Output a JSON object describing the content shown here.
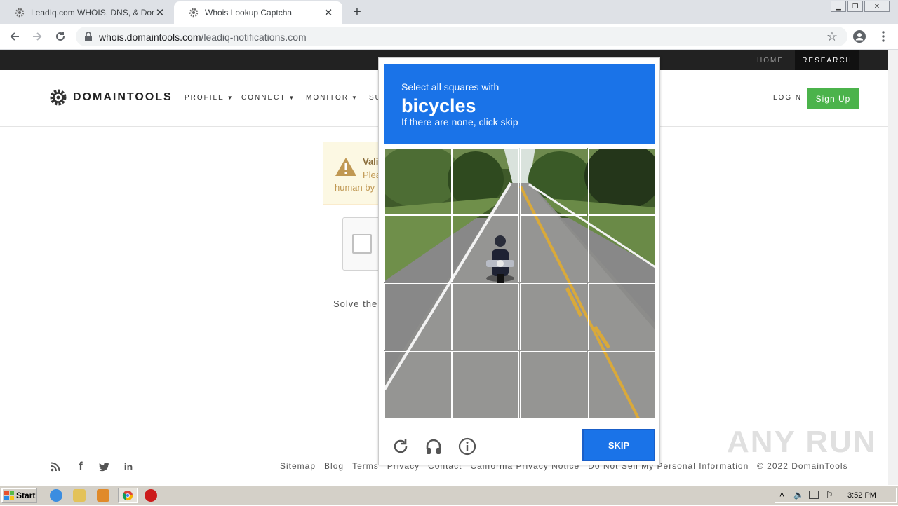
{
  "browser": {
    "tabs": [
      {
        "title": "LeadIq.com WHOIS, DNS, & Domain",
        "active": false
      },
      {
        "title": "Whois Lookup Captcha",
        "active": true
      }
    ],
    "url_host": "whois.domaintools.com",
    "url_path": "/leadiq-notifications.com"
  },
  "site": {
    "topbar": {
      "home": "HOME",
      "research": "RESEARCH"
    },
    "logo_text": "DOMAINTOOLS",
    "menu": [
      {
        "label": "PROFILE"
      },
      {
        "label": "CONNECT"
      },
      {
        "label": "MONITOR"
      },
      {
        "label": "SU"
      }
    ],
    "login": "LOGIN",
    "signup": "Sign Up",
    "notice": {
      "title": "Vali",
      "line1": "Plea",
      "line2": "human by"
    },
    "solve_text": "Solve the"
  },
  "captcha": {
    "instruction": "Select all squares with",
    "target": "bicycles",
    "hint": "If there are none, click skip",
    "skip_label": "SKIP",
    "accent": "#1a73e8"
  },
  "footer": {
    "links": [
      "Sitemap",
      "Blog",
      "Terms",
      "Privacy",
      "Contact",
      "California Privacy Notice",
      "Do Not Sell My Personal Information"
    ],
    "copyright": "© 2022 DomainTools"
  },
  "watermark": "ANY RUN",
  "taskbar": {
    "start": "Start",
    "clock": "3:52 PM"
  }
}
